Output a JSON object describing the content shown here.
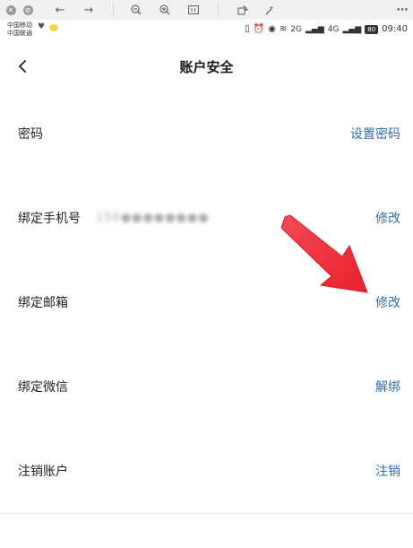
{
  "status_bar": {
    "carrier_1": "中国移动",
    "carrier_2": "中国联通",
    "network_1": "2G",
    "network_2": "4G",
    "battery": "80",
    "time": "09:40"
  },
  "header": {
    "title": "账户安全"
  },
  "rows": [
    {
      "label": "密码",
      "value": "",
      "action": "设置密码"
    },
    {
      "label": "绑定手机号",
      "value": "156●●●●●●●●",
      "action": "修改"
    },
    {
      "label": "绑定邮箱",
      "value": "",
      "action": "修改"
    },
    {
      "label": "绑定微信",
      "value": "",
      "action": "解绑"
    },
    {
      "label": "注销账户",
      "value": "",
      "action": "注销"
    }
  ],
  "colors": {
    "link": "#2d6ea8",
    "annotation_arrow": "#f0343f"
  },
  "icons": {
    "back": "chevron-left-icon",
    "annotation": "red-arrow-icon"
  }
}
